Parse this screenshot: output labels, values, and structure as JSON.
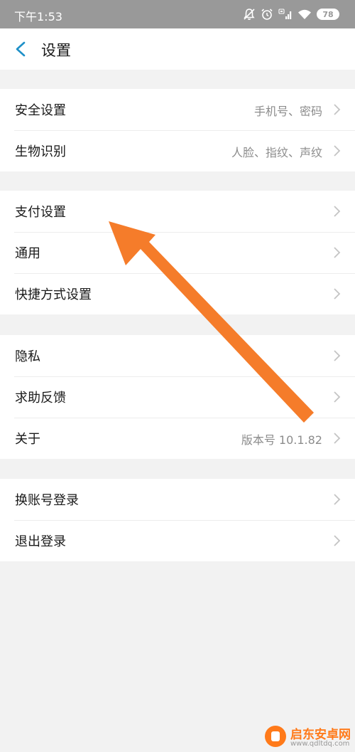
{
  "status_bar": {
    "time": "下午1:53",
    "icons": [
      "notifications-off-icon",
      "alarm-icon",
      "hd-signal-icon",
      "wifi-icon",
      "battery-icon"
    ],
    "battery": "78"
  },
  "header": {
    "back_icon": "chevron-left-icon",
    "title": "设置"
  },
  "groups": [
    {
      "items": [
        {
          "label": "安全设置",
          "value": "手机号、密码"
        },
        {
          "label": "生物识别",
          "value": "人脸、指纹、声纹"
        }
      ]
    },
    {
      "items": [
        {
          "label": "支付设置",
          "value": ""
        },
        {
          "label": "通用",
          "value": ""
        },
        {
          "label": "快捷方式设置",
          "value": ""
        }
      ]
    },
    {
      "items": [
        {
          "label": "隐私",
          "value": ""
        },
        {
          "label": "求助反馈",
          "value": ""
        },
        {
          "label": "关于",
          "value": "版本号 10.1.82"
        }
      ]
    },
    {
      "items": [
        {
          "label": "换账号登录",
          "value": ""
        },
        {
          "label": "退出登录",
          "value": ""
        }
      ]
    }
  ],
  "watermark": {
    "name": "启东安卓网",
    "url": "www.qdltdq.com"
  },
  "colors": {
    "status_bar": "#999999",
    "accent_back": "#1e90c8",
    "annotation_arrow": "#f57c2a",
    "chevron": "#c4c4c4"
  }
}
